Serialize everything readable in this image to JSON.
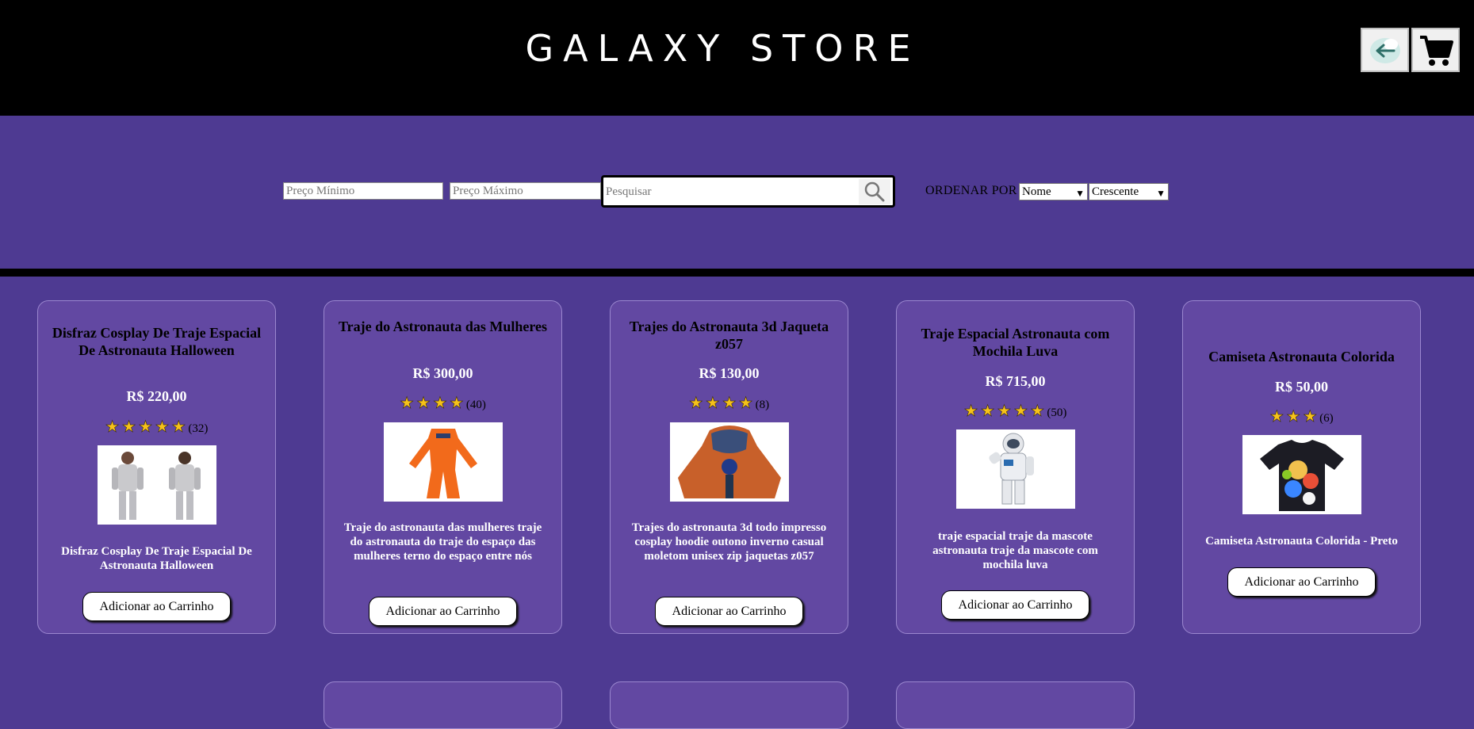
{
  "header": {
    "title": "GALAXY STORE"
  },
  "filters": {
    "min_price_placeholder": "Preço Mínimo",
    "max_price_placeholder": "Preço Máximo",
    "search_placeholder": "Pesquisar",
    "sort_label": "ORDENAR POR",
    "sort_field": "Nome",
    "sort_direction": "Crescente"
  },
  "colors": {
    "background": "#4e3a92",
    "card": "#6248a2",
    "header": "#000000",
    "star": "#f6c21a"
  },
  "products": [
    {
      "title": "Disfraz Cosplay De Traje Espacial De Astronauta Halloween",
      "price": "R$ 220,00",
      "stars": 5,
      "reviews": "(32)",
      "description": "Disfraz Cosplay De Traje Espacial De Astronauta Halloween",
      "button": "Adicionar ao Carrinho"
    },
    {
      "title": "Traje do Astronauta das Mulheres",
      "price": "R$ 300,00",
      "stars": 4,
      "reviews": "(40)",
      "description": "Traje do astronauta das mulheres traje do astronauta do traje do espaço das mulheres terno do espaço entre nós",
      "button": "Adicionar ao Carrinho"
    },
    {
      "title": "Trajes do Astronauta 3d Jaqueta z057",
      "price": "R$ 130,00",
      "stars": 4,
      "reviews": "(8)",
      "description": "Trajes do astronauta 3d todo impresso cosplay hoodie outono inverno casual moletom unisex zip jaquetas z057",
      "button": "Adicionar ao Carrinho"
    },
    {
      "title": "Traje Espacial Astronauta com Mochila Luva",
      "price": "R$ 715,00",
      "stars": 5,
      "reviews": "(50)",
      "description": "traje espacial traje da mascote astronauta traje da mascote com mochila luva",
      "button": "Adicionar ao Carrinho"
    },
    {
      "title": "Camiseta Astronauta Colorida",
      "price": "R$ 50,00",
      "stars": 3,
      "reviews": "(6)",
      "description": "Camiseta Astronauta Colorida - Preto",
      "button": "Adicionar ao Carrinho"
    }
  ]
}
